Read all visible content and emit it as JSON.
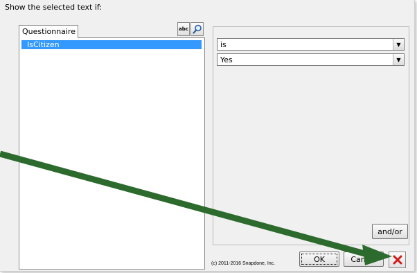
{
  "dialog": {
    "caption": "Show the selected text if:",
    "tab_label": "Questionnaire",
    "spell_button_label": "abc",
    "copyright": "(c) 2011-2016 Snapdone, Inc."
  },
  "variables": {
    "items": [
      {
        "label": "IsCitizen",
        "selected": true
      }
    ]
  },
  "condition": {
    "operator_value": "is",
    "value_value": "Yes"
  },
  "buttons": {
    "and_or_label": "and/or",
    "ok_label": "OK",
    "cancel_label": "Cancel"
  },
  "icons": {
    "search": "magnifier-icon",
    "close": "close-icon",
    "dropdown": "chevron-down-icon"
  },
  "colors": {
    "selection": "#3399ff",
    "close_x": "#d21a1a",
    "annotation_arrow": "#2d6a2d"
  }
}
